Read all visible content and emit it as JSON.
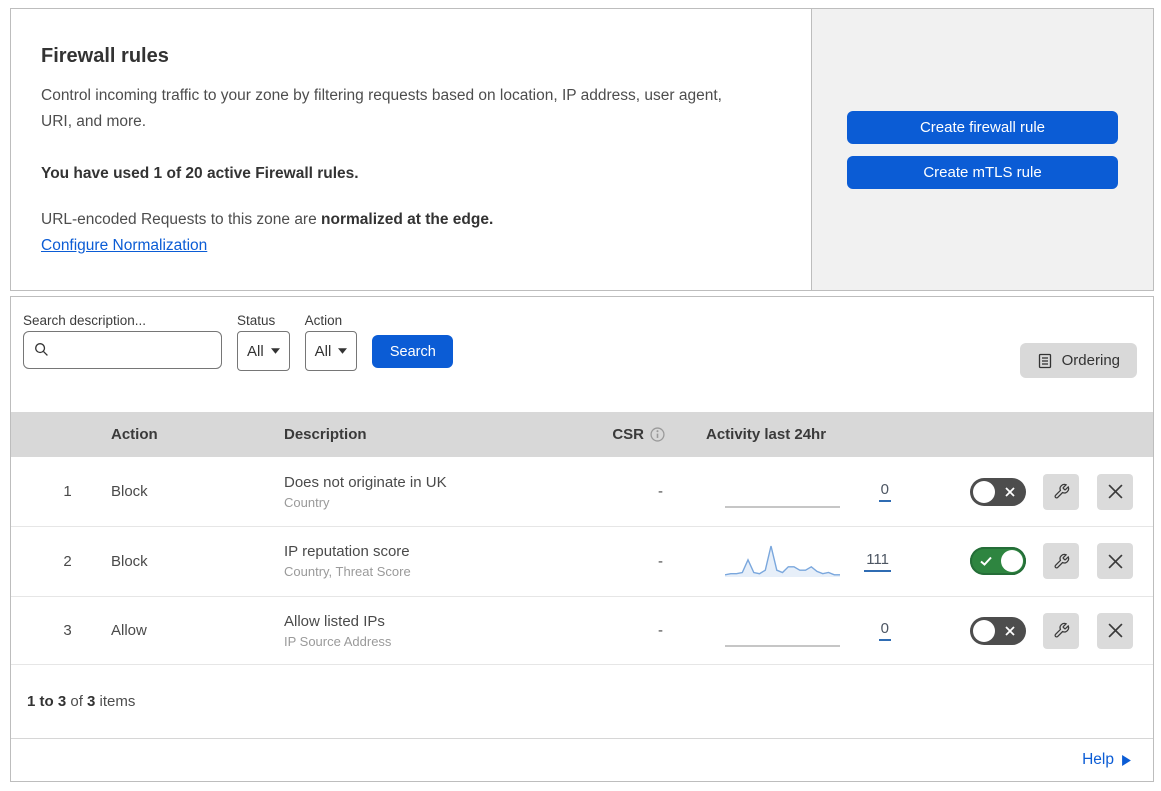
{
  "intro": {
    "title": "Firewall rules",
    "description": "Control incoming traffic to your zone by filtering requests based on location, IP address, user agent, URI, and more.",
    "usage_notice": "You have used 1 of 20 active Firewall rules.",
    "normalization_text": "URL-encoded Requests to this zone are ",
    "normalization_bold": "normalized at the edge.",
    "normalization_link": "Configure Normalization"
  },
  "side_panel": {
    "create_firewall_rule_label": "Create firewall rule",
    "create_mtls_rule_label": "Create mTLS rule"
  },
  "filters": {
    "search_label": "Search description...",
    "search_value": "",
    "status_label": "Status",
    "status_value": "All",
    "action_label": "Action",
    "action_value": "All",
    "search_button_label": "Search",
    "ordering_button_label": "Ordering"
  },
  "table": {
    "headers": {
      "action": "Action",
      "description": "Description",
      "csr": "CSR",
      "activity": "Activity last 24hr"
    },
    "rows": [
      {
        "number": "1",
        "action": "Block",
        "description": "Does not originate in UK",
        "match_fields": "Country",
        "csr": "-",
        "activity_count": "0",
        "enabled": false,
        "activity_sparkline": []
      },
      {
        "number": "2",
        "action": "Block",
        "description": "IP reputation score",
        "match_fields": "Country, Threat Score",
        "csr": "-",
        "activity_count": "111",
        "enabled": true,
        "activity_sparkline": [
          1,
          2,
          2,
          3,
          14,
          3,
          2,
          5,
          26,
          5,
          3,
          8,
          8,
          5,
          5,
          8,
          4,
          2,
          3,
          1,
          1
        ]
      },
      {
        "number": "3",
        "action": "Allow",
        "description": "Allow listed IPs",
        "match_fields": "IP Source Address",
        "csr": "-",
        "activity_count": "0",
        "enabled": false,
        "activity_sparkline": []
      }
    ]
  },
  "footer": {
    "range": "1 to 3",
    "of": " of ",
    "total": "3",
    "items": " items",
    "help_label": "Help"
  },
  "colors": {
    "accent_blue": "#0b5cd5",
    "toggle_on_green": "#2e8540",
    "toggle_off_gray": "#4d4d4d",
    "sparkline_blue": "#7aa7dd",
    "side_panel_gray": "#f1f1f1",
    "table_header_gray": "#d8d8d8"
  }
}
